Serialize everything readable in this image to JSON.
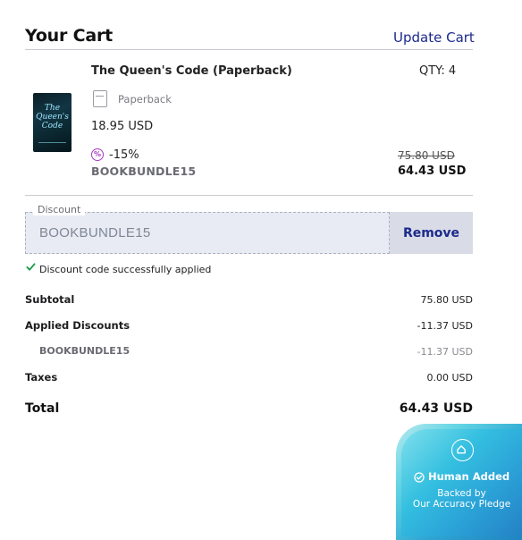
{
  "header": {
    "title": "Your Cart",
    "update_link": "Update Cart"
  },
  "item": {
    "title": "The Queen's Code (Paperback)",
    "qty_label": "QTY: 4",
    "cover_title": "The Queen's Code",
    "format": {
      "icon": "book-icon",
      "label": "Paperback"
    },
    "unit_price": "18.95 USD",
    "discount": {
      "icon": "percent-badge-icon",
      "percent": "-15%",
      "code": "BOOKBUNDLE15"
    },
    "original_total": "75.80 USD",
    "discounted_total": "64.43 USD"
  },
  "discount_field": {
    "legend": "Discount",
    "value": "BOOKBUNDLE15",
    "remove_label": "Remove",
    "success_icon": "checkmark-icon",
    "success_message": "Discount code successfully applied"
  },
  "summary": {
    "subtotal_label": "Subtotal",
    "subtotal_value": "75.80 USD",
    "discounts_label": "Applied Discounts",
    "discounts_value": "-11.37 USD",
    "discount_code_label": "BOOKBUNDLE15",
    "discount_code_value": "-11.37 USD",
    "taxes_label": "Taxes",
    "taxes_value": "0.00 USD",
    "total_label": "Total",
    "total_value": "64.43 USD"
  },
  "badge": {
    "icon": "home-shield-icon",
    "title": "Human Added",
    "line1": "Backed by",
    "line2": "Our Accuracy Pledge"
  },
  "colors": {
    "link": "#1c2a8c",
    "discount_accent": "#a63bbf",
    "success": "#1a9a4a",
    "badge_teal": "#34bfe0"
  }
}
